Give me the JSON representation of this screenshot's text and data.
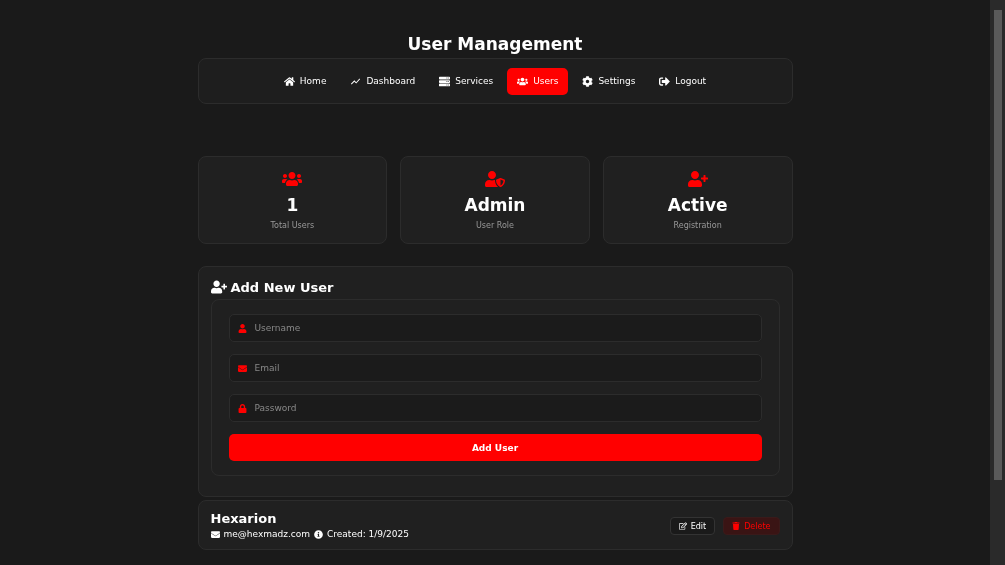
{
  "title": "User Management",
  "nav": [
    {
      "label": "Home",
      "kind": "home",
      "selected": false
    },
    {
      "label": "Dashboard",
      "kind": "chart",
      "selected": false
    },
    {
      "label": "Services",
      "kind": "server",
      "selected": false
    },
    {
      "label": "Users",
      "kind": "users",
      "selected": true
    },
    {
      "label": "Settings",
      "kind": "gear",
      "selected": false
    },
    {
      "label": "Logout",
      "kind": "logout",
      "selected": false
    }
  ],
  "stats": [
    {
      "kind": "users",
      "value": "1",
      "label": "Total Users"
    },
    {
      "kind": "shield",
      "value": "Admin",
      "label": "User Role"
    },
    {
      "kind": "adduser",
      "value": "Active",
      "label": "Registration"
    }
  ],
  "add_user": {
    "title": "Add New User",
    "fields": [
      {
        "kind": "user",
        "placeholder": "Username"
      },
      {
        "kind": "mail",
        "placeholder": "Email"
      },
      {
        "kind": "lock",
        "placeholder": "Password"
      }
    ],
    "button": "Add User"
  },
  "users": [
    {
      "name": "Hexarion",
      "email": "me@hexmadz.com",
      "created": "Created: 1/9/2025",
      "edit": "Edit",
      "delete": "Delete"
    }
  ]
}
